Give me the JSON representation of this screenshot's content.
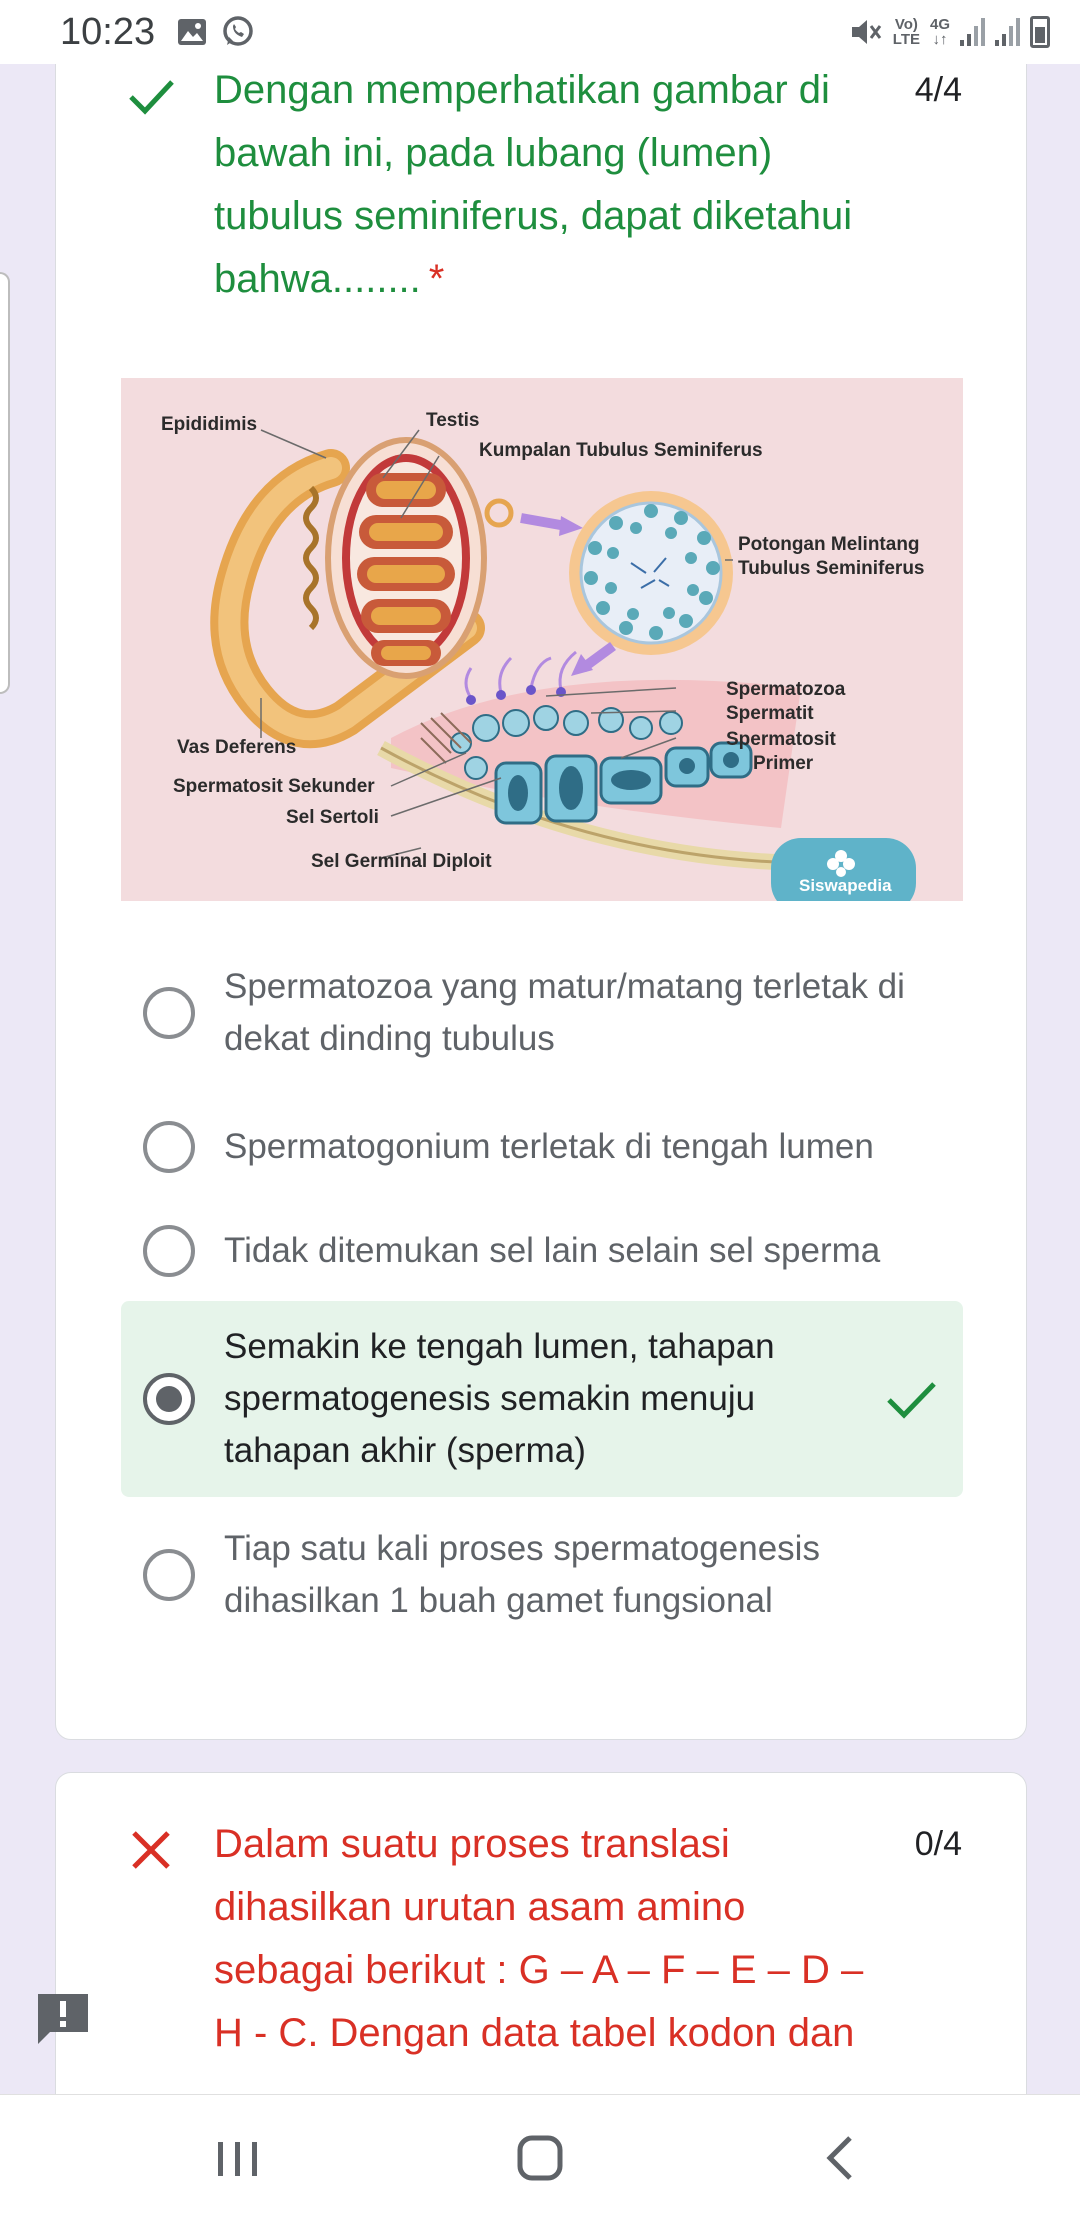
{
  "status_bar": {
    "time": "10:23",
    "left_icons": [
      "image-icon",
      "whatsapp-icon"
    ],
    "right_icons": [
      "mute-icon",
      "volte-icon",
      "4g-icon",
      "signal-icon",
      "signal-icon",
      "battery-icon"
    ],
    "volte_top": "Vo)",
    "volte_bottom": "LTE",
    "net_top": "4G",
    "net_bottom": "↓↑"
  },
  "question1": {
    "status": "correct",
    "text": "Dengan memperhatikan gambar di bawah ini, pada lubang (lumen) tubulus seminiferus, dapat diketahui bahwa........",
    "required_mark": "*",
    "score": "4/4",
    "figure": {
      "labels": {
        "epididimis": "Epididimis",
        "testis": "Testis",
        "kumpalan": "Kumpalan Tubulus Seminiferus",
        "potongan1": "Potongan Melintang",
        "potongan2": "Tubulus Seminiferus",
        "spermatozoa": "Spermatozoa",
        "spermatit": "Spermatit",
        "spermatosit1": "Spermatosit",
        "spermatosit2": "Primer",
        "vas": "Vas Deferens",
        "sekunder": "Spermatosit Sekunder",
        "sertoli": "Sel Sertoli",
        "germinal": "Sel Germinal Diploit",
        "watermark": "Siswapedia"
      }
    },
    "options": [
      {
        "label": "Spermatozoa yang matur/matang terletak di dekat dinding tubulus",
        "selected": false
      },
      {
        "label": "Spermatogonium terletak di tengah lumen",
        "selected": false
      },
      {
        "label": "Tidak ditemukan sel lain selain sel sperma",
        "selected": false
      },
      {
        "label": "Semakin ke tengah lumen, tahapan spermatogenesis semakin menuju tahapan akhir (sperma)",
        "selected": true
      },
      {
        "label": "Tiap satu kali proses spermatogenesis dihasilkan 1 buah gamet fungsional",
        "selected": false
      }
    ]
  },
  "question2": {
    "status": "wrong",
    "text": "Dalam suatu proses translasi dihasilkan urutan asam amino sebagai berikut : G – A – F – E – D – H - C. Dengan data tabel kodon dan",
    "score": "0/4"
  },
  "colors": {
    "correct": "#1e8e3e",
    "wrong": "#d93025",
    "selected_bg": "#e6f4ea",
    "page_bg": "#ece8f6"
  },
  "nav_bar": [
    "recent-apps-icon",
    "home-icon",
    "back-icon"
  ]
}
